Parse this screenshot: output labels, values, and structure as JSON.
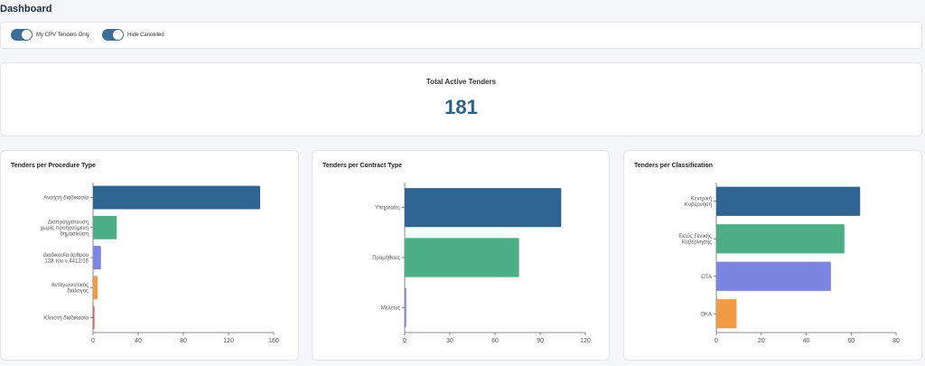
{
  "page": {
    "title": "Dashboard"
  },
  "toggles": [
    {
      "label": "My CPV Tenders Only",
      "on": true
    },
    {
      "label": "Hide Cancelled",
      "on": true
    }
  ],
  "total": {
    "label": "Total Active Tenders",
    "value": "181"
  },
  "colors": {
    "switch_on": "#3b6f98",
    "value_text": "#2d5f8a"
  },
  "chart_data": [
    {
      "type": "bar",
      "orientation": "horizontal",
      "title": "Tenders per Procedure Type",
      "categories": [
        [
          "Ανοιχτή διαδικασία"
        ],
        [
          "Διαπραγμάτευση",
          "χωρίς προηγούμενη",
          "δημοσίευση"
        ],
        [
          "Διαδικασία άρθρου",
          "128 του ν.4412/16"
        ],
        [
          "Ανταγωνιστικός",
          "διάλογος"
        ],
        [
          "Κλειστή διαδικασία"
        ]
      ],
      "values": [
        148,
        21,
        7,
        4,
        1
      ],
      "colors": [
        "#2e6592",
        "#4caf85",
        "#7b86e2",
        "#f29b45",
        "#e0534f"
      ],
      "xlim": [
        0,
        160
      ],
      "ticks": [
        0,
        40,
        80,
        120,
        160
      ],
      "grid": false
    },
    {
      "type": "bar",
      "orientation": "horizontal",
      "title": "Tenders per Contract Type",
      "categories": [
        [
          "Υπηρεσίες"
        ],
        [
          "Προμήθειες"
        ],
        [
          "Μελέτες"
        ]
      ],
      "values": [
        104,
        76,
        1
      ],
      "colors": [
        "#2e6592",
        "#4caf85",
        "#7b86e2"
      ],
      "xlim": [
        0,
        120
      ],
      "ticks": [
        0,
        30,
        60,
        90,
        120
      ],
      "grid": false
    },
    {
      "type": "bar",
      "orientation": "horizontal",
      "title": "Tenders per Classification",
      "categories": [
        [
          "Κεντρική",
          "Κυβέρνηση"
        ],
        [
          "Εκτός Γενικής",
          "Κυβέρνησης"
        ],
        [
          "ΟΤΑ"
        ],
        [
          "ΟΚΑ"
        ]
      ],
      "values": [
        64,
        57,
        51,
        9
      ],
      "colors": [
        "#2e6592",
        "#4caf85",
        "#7b86e2",
        "#f29b45"
      ],
      "xlim": [
        0,
        80
      ],
      "ticks": [
        0,
        20,
        40,
        60,
        80
      ],
      "grid": false
    }
  ]
}
